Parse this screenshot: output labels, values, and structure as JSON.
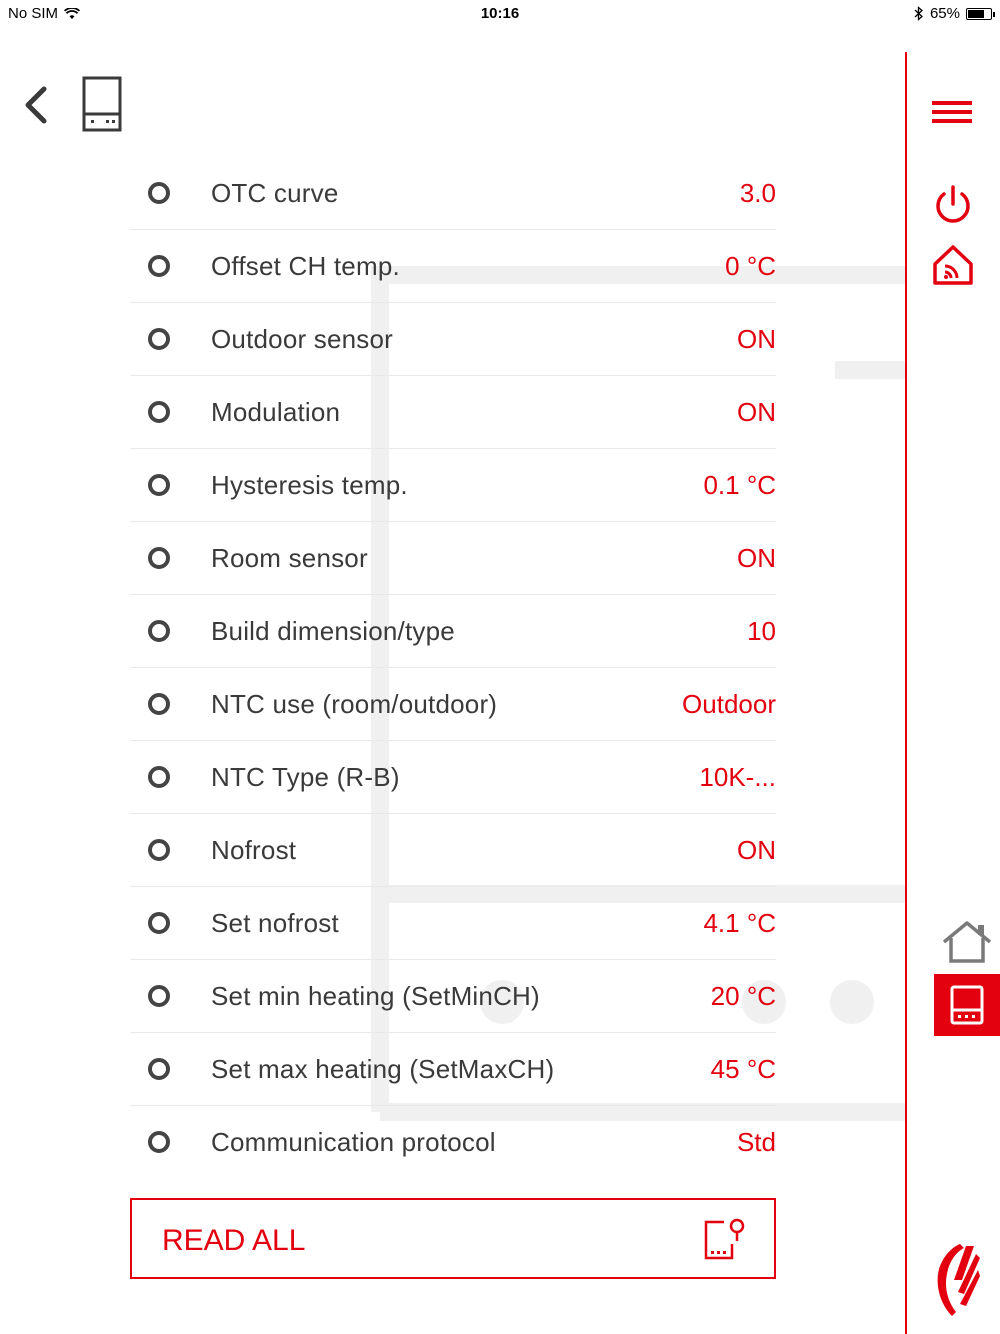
{
  "status_bar": {
    "carrier": "No SIM",
    "time": "10:16",
    "battery_percent": "65%",
    "battery_level": 0.65
  },
  "icons": {
    "back": "chevron-left-icon",
    "device": "boiler-icon",
    "menu": "hamburger-menu-icon",
    "power": "power-icon",
    "smart_home": "smart-home-icon",
    "home": "house-icon",
    "boiler_tab": "boiler-icon",
    "read_all": "read-device-icon",
    "logo": "brand-logo"
  },
  "colors": {
    "accent": "#e3000f",
    "text": "#3a3a3a"
  },
  "params": [
    {
      "label": "OTC curve",
      "value": "3.0"
    },
    {
      "label": "Offset CH temp.",
      "value": "0 °C"
    },
    {
      "label": "Outdoor sensor",
      "value": "ON"
    },
    {
      "label": "Modulation",
      "value": "ON"
    },
    {
      "label": "Hysteresis temp.",
      "value": "0.1 °C"
    },
    {
      "label": "Room sensor",
      "value": "ON"
    },
    {
      "label": "Build dimension/type",
      "value": "10"
    },
    {
      "label": "NTC use (room/outdoor)",
      "value": "Outdoor"
    },
    {
      "label": "NTC Type (R-B)",
      "value": "10K-..."
    },
    {
      "label": "Nofrost",
      "value": "ON"
    },
    {
      "label": "Set nofrost",
      "value": "4.1 °C"
    },
    {
      "label": "Set min heating (SetMinCH)",
      "value": "20 °C"
    },
    {
      "label": "Set max heating (SetMaxCH)",
      "value": "45 °C"
    },
    {
      "label": "Communication protocol",
      "value": "Std"
    }
  ],
  "read_all": {
    "label": "READ ALL"
  }
}
